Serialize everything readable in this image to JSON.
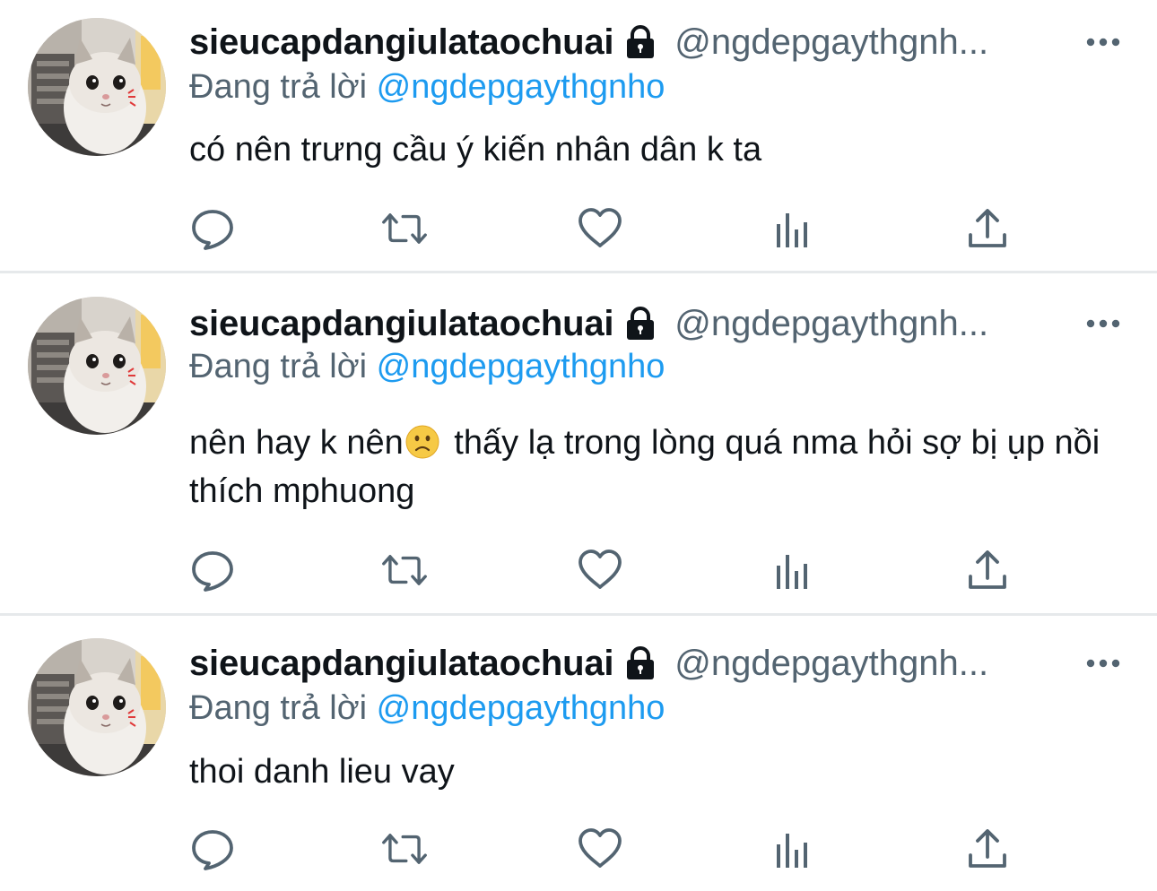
{
  "colors": {
    "text_primary": "#0f1419",
    "text_secondary": "#536471",
    "link": "#1d9bf0",
    "divider": "#e6e9eb",
    "icon": "#536471"
  },
  "tweets": [
    {
      "display_name": "sieucapdangiulataochuai",
      "handle": "@ngdepgaythgnh...",
      "reply_prefix": "Đang trả lời",
      "reply_to": "@ngdepgaythgnho",
      "text": "có nên trưng cầu ý kiến nhân dân k ta",
      "avatar_icon": "cat-avatar",
      "lock_icon": "lock-icon"
    },
    {
      "display_name": "sieucapdangiulataochuai",
      "handle": "@ngdepgaythgnh...",
      "reply_prefix": "Đang trả lời",
      "reply_to": "@ngdepgaythgnho",
      "text_part1": "nên hay k nên",
      "emoji": "slightly-frowning-face",
      "text_part2": " thấy lạ trong lòng quá nma hỏi sợ bị ụp nồi thích mphuong",
      "avatar_icon": "cat-avatar",
      "lock_icon": "lock-icon"
    },
    {
      "display_name": "sieucapdangiulataochuai",
      "handle": "@ngdepgaythgnh...",
      "reply_prefix": "Đang trả lời",
      "reply_to": "@ngdepgaythgnho",
      "text": "thoi danh lieu vay",
      "avatar_icon": "cat-avatar",
      "lock_icon": "lock-icon"
    }
  ],
  "action_icons": [
    "reply-icon",
    "retweet-icon",
    "like-icon",
    "stats-icon",
    "share-icon"
  ],
  "more_icon": "more-icon"
}
